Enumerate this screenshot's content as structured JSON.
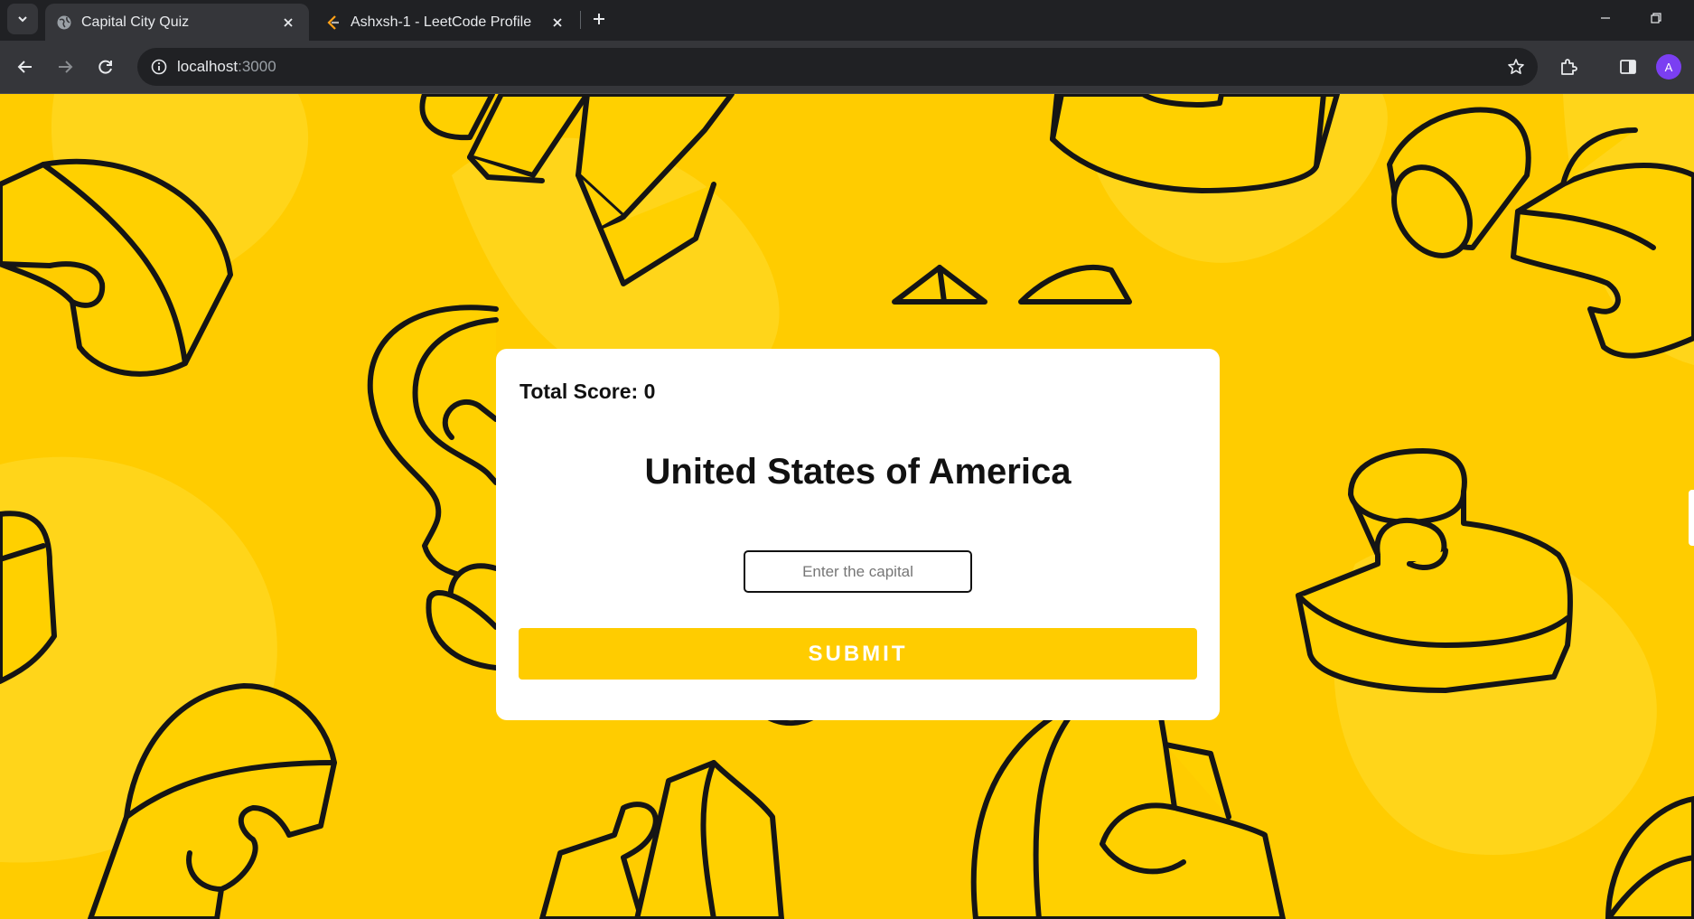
{
  "browser": {
    "tabs": [
      {
        "title": "Capital City Quiz",
        "active": true,
        "icon": "globe-icon"
      },
      {
        "title": "Ashxsh-1 - LeetCode Profile",
        "active": false,
        "icon": "leetcode-icon"
      }
    ],
    "address": {
      "host": "localhost",
      "port": ":3000"
    },
    "profile_initial": "A",
    "accent_color": "#7b3ff2"
  },
  "quiz": {
    "score_label": "Total Score: 0",
    "country": "United States of America",
    "input_placeholder": "Enter the capital",
    "input_value": "",
    "submit_label": "SUBMIT"
  },
  "colors": {
    "background": "#ffcc00",
    "card": "#ffffff",
    "button": "#ffcc00"
  }
}
